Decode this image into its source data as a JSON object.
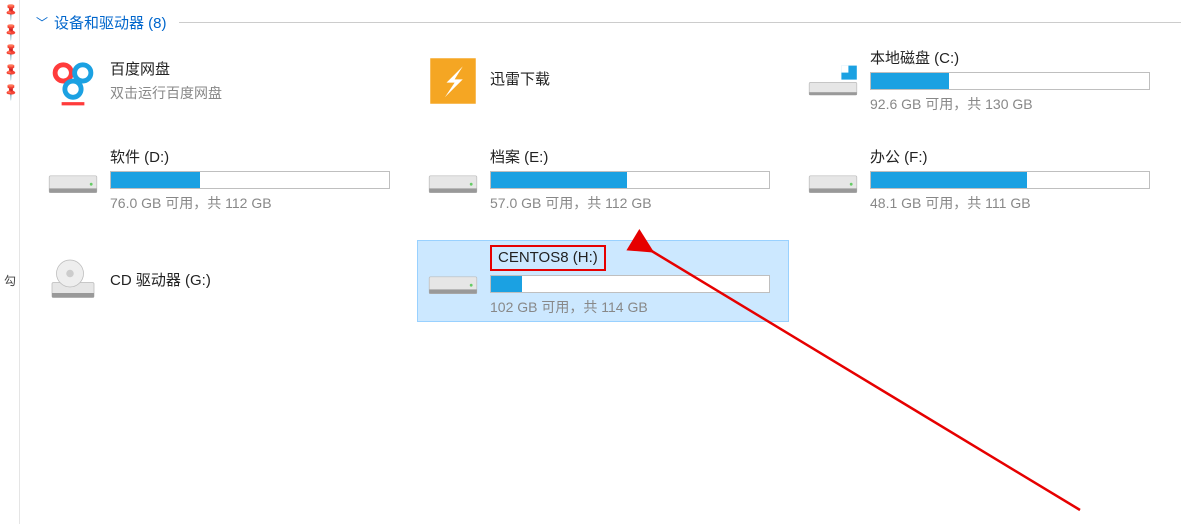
{
  "section": {
    "title": "设备和驱动器 (8)"
  },
  "items": [
    {
      "kind": "app",
      "icon": "baidu",
      "title": "百度网盘",
      "sub": "双击运行百度网盘"
    },
    {
      "kind": "app",
      "icon": "xunlei",
      "title": "迅雷下载",
      "sub": ""
    },
    {
      "kind": "drive",
      "icon": "sys",
      "title": "本地磁盘 (C:)",
      "sub": "92.6 GB 可用，共 130 GB",
      "fill": 28
    },
    {
      "kind": "drive",
      "icon": "hdd",
      "title": "软件 (D:)",
      "sub": "76.0 GB 可用，共 112 GB",
      "fill": 32
    },
    {
      "kind": "drive",
      "icon": "hdd",
      "title": "档案 (E:)",
      "sub": "57.0 GB 可用，共 112 GB",
      "fill": 49
    },
    {
      "kind": "drive",
      "icon": "hdd",
      "title": "办公 (F:)",
      "sub": "48.1 GB 可用，共 111 GB",
      "fill": 56
    },
    {
      "kind": "disc",
      "icon": "cd",
      "title": "CD 驱动器 (G:)",
      "sub": ""
    },
    {
      "kind": "drive",
      "icon": "hdd",
      "title": "CENTOS8 (H:)",
      "sub": "102 GB 可用，共 114 GB",
      "fill": 11,
      "selected": true,
      "highlight": true
    }
  ]
}
